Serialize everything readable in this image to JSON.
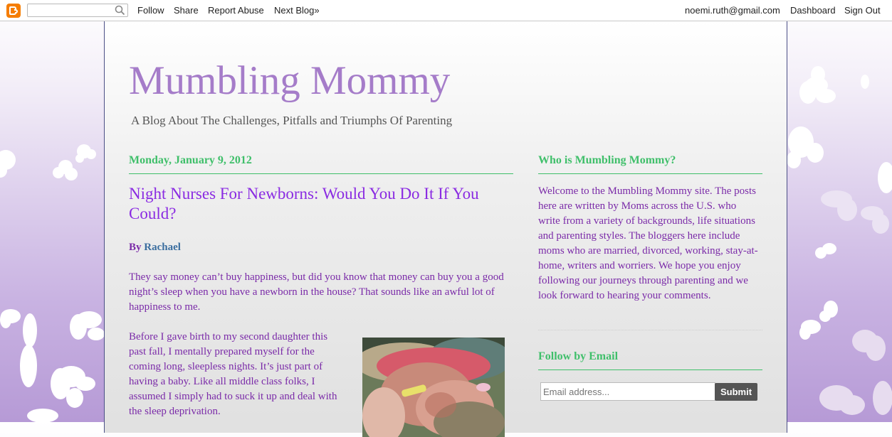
{
  "navbar": {
    "logo_icon": "blogger-icon",
    "search_placeholder": "",
    "links": [
      "Follow",
      "Share",
      "Report Abuse",
      "Next Blog»"
    ],
    "user_email": "noemi.ruth@gmail.com",
    "dashboard": "Dashboard",
    "sign_out": "Sign Out"
  },
  "header": {
    "title": "Mumbling Mommy",
    "description": "A Blog About The Challenges, Pitfalls and Triumphs Of Parenting"
  },
  "post": {
    "date": "Monday, January 9, 2012",
    "title": "Night Nurses For Newborns: Would You Do It If You Could?",
    "by_prefix": "By",
    "author": "Rachael",
    "paragraph1": "They say money can’t buy happiness, but did you know that money can buy you a good night’s sleep when you have a newborn in the house? That sounds like an awful lot of happiness to me.",
    "paragraph2": "Before I gave birth to my second daughter this past fall, I mentally prepared myself for the coming long, sleepless nights. It’s just part of having a baby. Like all middle class folks, I assumed I simply had to suck it up and deal with the sleep deprivation."
  },
  "sidebar": {
    "about_heading": "Who is Mumbling Mommy?",
    "about_text": "Welcome to the Mumbling Mommy site. The posts here are written by Moms across the U.S. who write from a variety of backgrounds, life situations and parenting styles. The bloggers here include moms who are married, divorced, working, stay-at-home, writers and worriers. We hope you enjoy following our journeys through parenting and we look forward to hearing your comments.",
    "follow_heading": "Follow by Email",
    "email_placeholder": "Email address...",
    "submit_label": "Submit"
  },
  "colors": {
    "title": "#a57cc9",
    "heading_green": "#3fbf6a",
    "body_purple": "#7a2aa8",
    "link_blue": "#3b6e9f",
    "blogger_orange": "#f57d00"
  }
}
